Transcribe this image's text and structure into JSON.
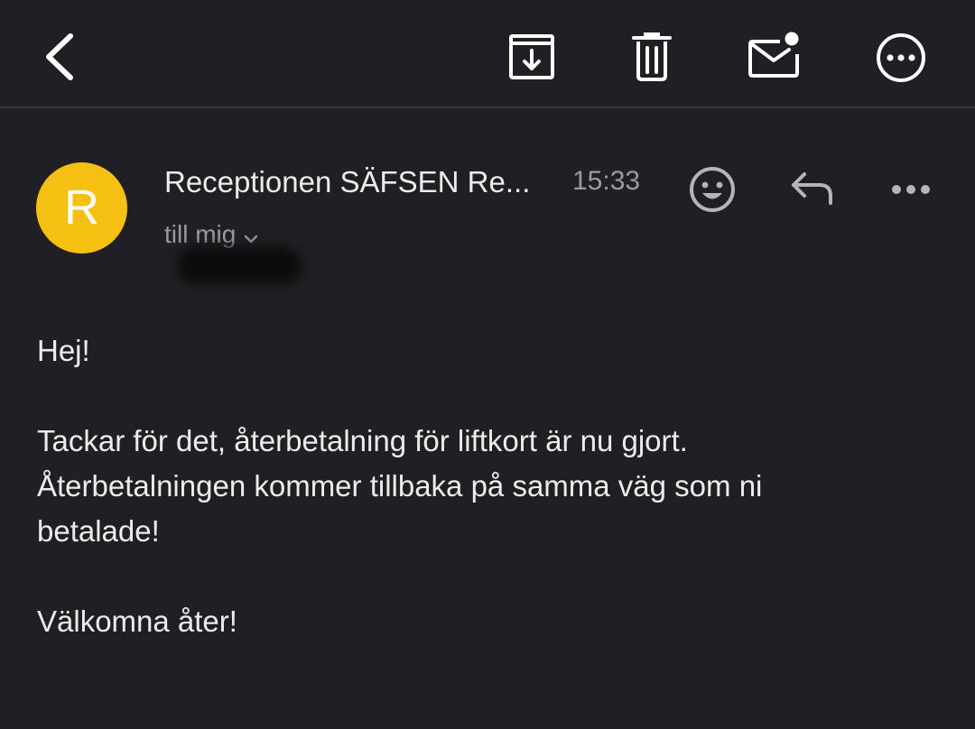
{
  "toolbar": {
    "back_icon": "chevron-left-icon",
    "archive_icon": "archive-icon",
    "delete_icon": "trash-icon",
    "mark_unread_icon": "mail-unread-icon",
    "more_icon": "more-circle-icon"
  },
  "message": {
    "sender": {
      "initial": "R",
      "name": "Receptionen SÄFSEN Re...",
      "time": "15:33",
      "recipient": "till mig",
      "avatar_color": "#f6c012"
    },
    "actions": {
      "emoji_icon": "emoji-icon",
      "reply_icon": "reply-icon",
      "more_icon": "more-horizontal-icon"
    },
    "body": {
      "greeting": "Hej!",
      "line1": "Tackar för det, återbetalning för liftkort är nu gjort.",
      "line2": "Återbetalningen kommer tillbaka på samma väg som ni",
      "line3": "betalade!",
      "closing": "Välkomna åter!"
    }
  },
  "colors": {
    "background": "#202024",
    "text_primary": "#ececec",
    "text_secondary": "#9a9aa0"
  }
}
